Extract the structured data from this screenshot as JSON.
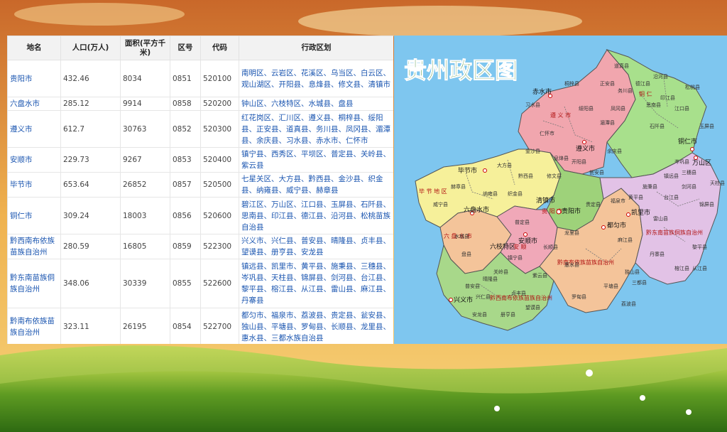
{
  "table": {
    "headers": [
      "地名",
      "人口(万人)",
      "面积(平方千米)",
      "区号",
      "代码",
      "行政区划"
    ],
    "rows": [
      {
        "name": "贵阳市",
        "pop": "432.46",
        "area": "8034",
        "code": "0851",
        "admin": "520100",
        "divisions": "南明区、云岩区、花溪区、乌当区、白云区、观山湖区、开阳县、息烽县、修文县、清镇市"
      },
      {
        "name": "六盘水市",
        "pop": "285.12",
        "area": "9914",
        "code": "0858",
        "admin": "520200",
        "divisions": "钟山区、六枝特区、水城县、盘县"
      },
      {
        "name": "遵义市",
        "pop": "612.7",
        "area": "30763",
        "code": "0852",
        "admin": "520300",
        "divisions": "红花岗区、汇川区、遵义县、桐梓县、绥阳县、正安县、道真县、务川县、凤冈县、湄潭县、余庆县、习水县、赤水市、仁怀市"
      },
      {
        "name": "安顺市",
        "pop": "229.73",
        "area": "9267",
        "code": "0853",
        "admin": "520400",
        "divisions": "镇宁县、西秀区、平坝区、普定县、关岭县、紫云县"
      },
      {
        "name": "毕节市",
        "pop": "653.64",
        "area": "26852",
        "code": "0857",
        "admin": "520500",
        "divisions": "七星关区、大方县、黔西县、金沙县、织金县、纳雍县、威宁县、赫章县"
      },
      {
        "name": "铜仁市",
        "pop": "309.24",
        "area": "18003",
        "code": "0856",
        "admin": "520600",
        "divisions": "碧江区、万山区、江口县、玉屏县、石阡县、思南县、印江县、德江县、沿河县、松桃苗族自治县"
      },
      {
        "name": "黔西南布依族苗族自治州",
        "pop": "280.59",
        "area": "16805",
        "code": "0859",
        "admin": "522300",
        "divisions": "兴义市、兴仁县、普安县、晴隆县、贞丰县、望谟县、册亨县、安龙县"
      },
      {
        "name": "黔东南苗族侗族自治州",
        "pop": "348.06",
        "area": "30339",
        "code": "0855",
        "admin": "522600",
        "divisions": "镇远县、凯里市、黄平县、施秉县、三穗县、岑巩县、天柱县、锦屏县、剑河县、台江县、黎平县、榕江县、从江县、雷山县、麻江县、丹寨县"
      },
      {
        "name": "黔南布依族苗族自治州",
        "pop": "323.11",
        "area": "26195",
        "code": "0854",
        "admin": "522700",
        "divisions": "都匀市、福泉市、荔波县、贵定县、瓮安县、独山县、平塘县、罗甸县、长顺县、龙里县、惠水县、三都水族自治县"
      }
    ]
  },
  "map": {
    "title": "贵州政区图",
    "prefecture_labels": {
      "bijie": "毕 节 地 区",
      "zunyi": "遵 义 市",
      "tongren": "铜 仁",
      "liupanshui": "六 盘 水 市",
      "anshun": "安 顺",
      "guiyang": "贵 阳 市",
      "qiannan": "黔南布依族苗族自治州",
      "qiandongnan": "黔东南苗族侗族自治州",
      "qianxinan": "黔西南布依族苗族自治州"
    },
    "cities": {
      "bijie": "毕节市",
      "zunyi": "遵义市",
      "tongren": "铜仁市",
      "liupanshui": "六盘水市",
      "anshun": "安顺市",
      "guiyang": "贵阳市",
      "kaili": "凯里市",
      "duyun": "都匀市",
      "xingyi": "兴义市",
      "chishui": "赤水市",
      "wanshan": "万山区",
      "liuzhi": "六枝特区",
      "qingzhen": "清镇市"
    },
    "counties": [
      "习水县",
      "仁怀市",
      "桐梓县",
      "绥阳县",
      "正安县",
      "道真县",
      "务川县",
      "凤冈县",
      "湄潭县",
      "余庆县",
      "德江县",
      "沿河县",
      "思南县",
      "印江县",
      "石阡县",
      "江口县",
      "松桃县",
      "玉屏县",
      "大方县",
      "黔西县",
      "金沙县",
      "织金县",
      "纳雍县",
      "威宁县",
      "赫章县",
      "水城县",
      "盘县",
      "普定县",
      "镇宁县",
      "关岭县",
      "紫云县",
      "普安县",
      "晴隆县",
      "兴仁县",
      "贞丰县",
      "安龙县",
      "册亨县",
      "望谟县",
      "长顺县",
      "惠水县",
      "罗甸县",
      "平塘县",
      "独山县",
      "荔波县",
      "三都县",
      "龙里县",
      "贵定县",
      "瓮安县",
      "福泉市",
      "麻江县",
      "丹寨县",
      "雷山县",
      "台江县",
      "剑河县",
      "锦屏县",
      "天柱县",
      "三穗县",
      "镇远县",
      "施秉县",
      "黄平县",
      "岑巩县",
      "黎平县",
      "榕江县",
      "从江县",
      "开阳县",
      "息烽县",
      "修文县"
    ],
    "colors": {
      "bijie": "#f6f09a",
      "zunyi": "#f1a6ae",
      "tongren": "#a8e08c",
      "liupanshui": "#f4c49a",
      "anshun": "#f0a8b8",
      "guiyang": "#9ed27a",
      "qiannan": "#f4c49a",
      "qiandongnan": "#e2c2e6",
      "qianxinan": "#a8d88a",
      "sky": "#7ec6ef"
    }
  }
}
